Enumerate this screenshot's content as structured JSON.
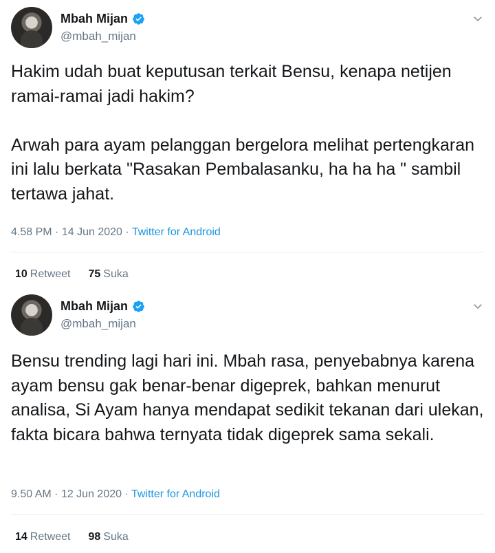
{
  "tweets": [
    {
      "author_name": "Mbah Mijan",
      "handle": "@mbah_mijan",
      "text": "Hakim udah buat keputusan terkait Bensu, kenapa netijen ramai-ramai jadi hakim?\n\nArwah para ayam pelanggan bergelora melihat pertengkaran ini lalu berkata \"Rasakan Pembalasanku, ha ha ha \" sambil tertawa jahat.",
      "time": "4.58 PM",
      "date": "14 Jun 2020",
      "source": "Twitter for Android",
      "retweets": "10",
      "retweet_label": "Retweet",
      "likes": "75",
      "like_label": "Suka"
    },
    {
      "author_name": "Mbah Mijan",
      "handle": "@mbah_mijan",
      "text": "Bensu trending lagi hari ini. Mbah rasa, penyebabnya karena ayam bensu gak benar-benar digeprek, bahkan menurut analisa, Si Ayam hanya mendapat sedikit tekanan dari ulekan, fakta bicara bahwa ternyata tidak digeprek sama sekali.",
      "time": "9.50 AM",
      "date": "12 Jun 2020",
      "source": "Twitter for Android",
      "retweets": "14",
      "retweet_label": "Retweet",
      "likes": "98",
      "like_label": "Suka"
    }
  ],
  "separator": "·",
  "colors": {
    "link": "#1b95e0",
    "verified": "#1da1f2",
    "muted": "#657786"
  },
  "icons": {
    "verified": "verified-badge-icon",
    "menu": "chevron-down-icon"
  }
}
